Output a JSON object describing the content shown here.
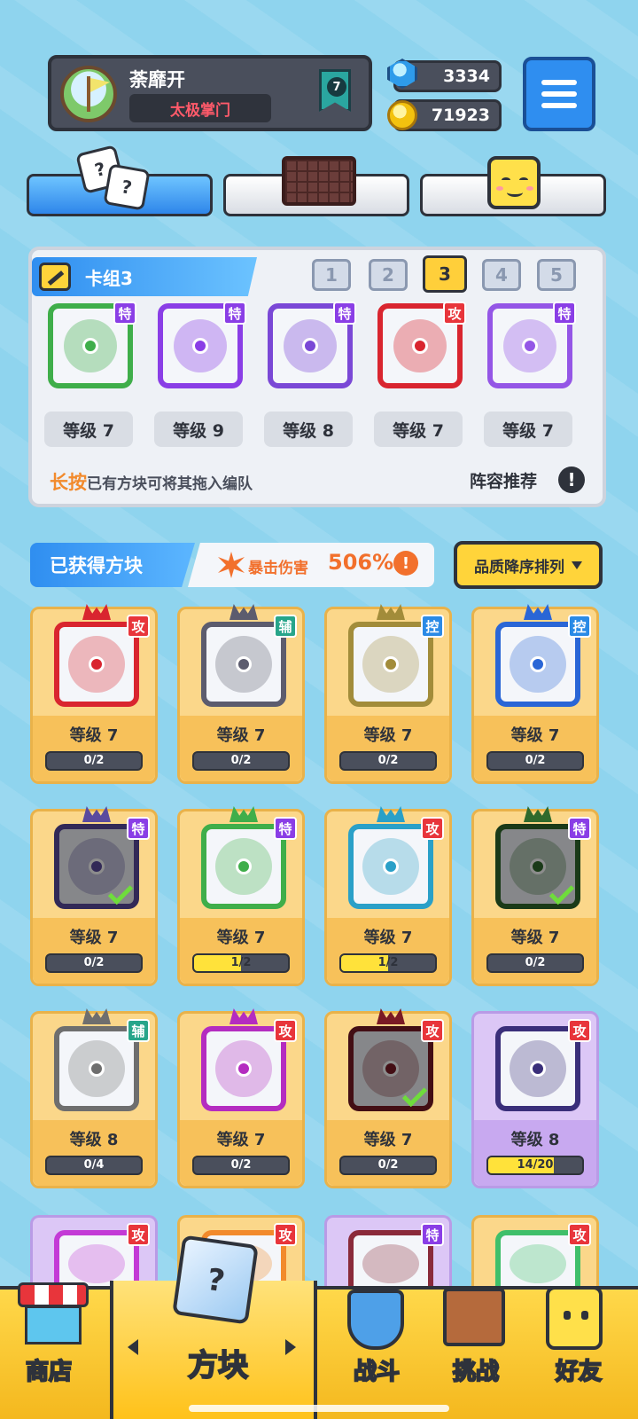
{
  "player": {
    "name": "荼靡开",
    "clan": "太极掌门",
    "rank": "7"
  },
  "currency": {
    "gems": "3334",
    "coins": "71923"
  },
  "tabs": [
    {
      "name": "dice",
      "icon": "dice-icon",
      "active": true
    },
    {
      "name": "board",
      "icon": "board-icon",
      "active": false
    },
    {
      "name": "emote",
      "icon": "smiley-icon",
      "active": false
    }
  ],
  "deck": {
    "title": "卡组3",
    "numbers": [
      "1",
      "2",
      "3",
      "4",
      "5"
    ],
    "active_number": "3",
    "cards": [
      {
        "tag": "特",
        "level": "等级 7",
        "color": "#3fae4a"
      },
      {
        "tag": "特",
        "level": "等级 9",
        "color": "#8a3ee6"
      },
      {
        "tag": "特",
        "level": "等级 8",
        "color": "#7a48d6"
      },
      {
        "tag": "攻",
        "level": "等级 7",
        "color": "#d9252f"
      },
      {
        "tag": "特",
        "level": "等级 7",
        "color": "#9456e6"
      }
    ],
    "hint_highlight": "长按",
    "hint_text": "已有方块可将其拖入编队",
    "recommend_label": "阵容推荐",
    "info_glyph": "!"
  },
  "collection": {
    "title": "已获得方块",
    "crit_label": "暴击伤害",
    "crit_value": "506%",
    "crit_info_glyph": "!",
    "sort_label": "品质降序排列",
    "items": [
      {
        "tag": "攻",
        "level": "等级 7",
        "progress": "0/2",
        "fill": 0,
        "color": "#d9252f"
      },
      {
        "tag": "辅",
        "level": "等级 7",
        "progress": "0/2",
        "fill": 0,
        "color": "#5c5c6e"
      },
      {
        "tag": "控",
        "level": "等级 7",
        "progress": "0/2",
        "fill": 0,
        "color": "#a28c3a"
      },
      {
        "tag": "控",
        "level": "等级 7",
        "progress": "0/2",
        "fill": 0,
        "color": "#2a66d6"
      },
      {
        "tag": "特",
        "level": "等级 7",
        "progress": "0/2",
        "fill": 0,
        "color": "#5a4a9e",
        "checked": true
      },
      {
        "tag": "特",
        "level": "等级 7",
        "progress": "1/2",
        "fill": 0.5,
        "color": "#3fae4a"
      },
      {
        "tag": "攻",
        "level": "等级 7",
        "progress": "1/2",
        "fill": 0.5,
        "color": "#2aa0c8"
      },
      {
        "tag": "特",
        "level": "等级 7",
        "progress": "0/2",
        "fill": 0,
        "color": "#2f6a2c",
        "checked": true
      },
      {
        "tag": "辅",
        "level": "等级 8",
        "progress": "0/4",
        "fill": 0,
        "color": "#6e6e6e"
      },
      {
        "tag": "攻",
        "level": "等级 7",
        "progress": "0/2",
        "fill": 0,
        "color": "#b42cc0"
      },
      {
        "tag": "攻",
        "level": "等级 7",
        "progress": "0/2",
        "fill": 0,
        "color": "#7a1a24",
        "checked": true
      },
      {
        "tag": "攻",
        "level": "等级 8",
        "progress": "14/20",
        "fill": 0.7,
        "color": "#3a2f7a",
        "purple": true
      }
    ],
    "partial_items": [
      {
        "tag": "攻",
        "color": "#c33ad6",
        "purple": true
      },
      {
        "tag": "攻",
        "color": "#f28a2c"
      },
      {
        "tag": "特",
        "color": "#8a2a3a",
        "purple": true
      },
      {
        "tag": "攻",
        "color": "#3fbf6a"
      }
    ]
  },
  "nav": {
    "shop": "商店",
    "dice": "方块",
    "battle": "战斗",
    "challenge": "挑战",
    "friends": "好友"
  }
}
